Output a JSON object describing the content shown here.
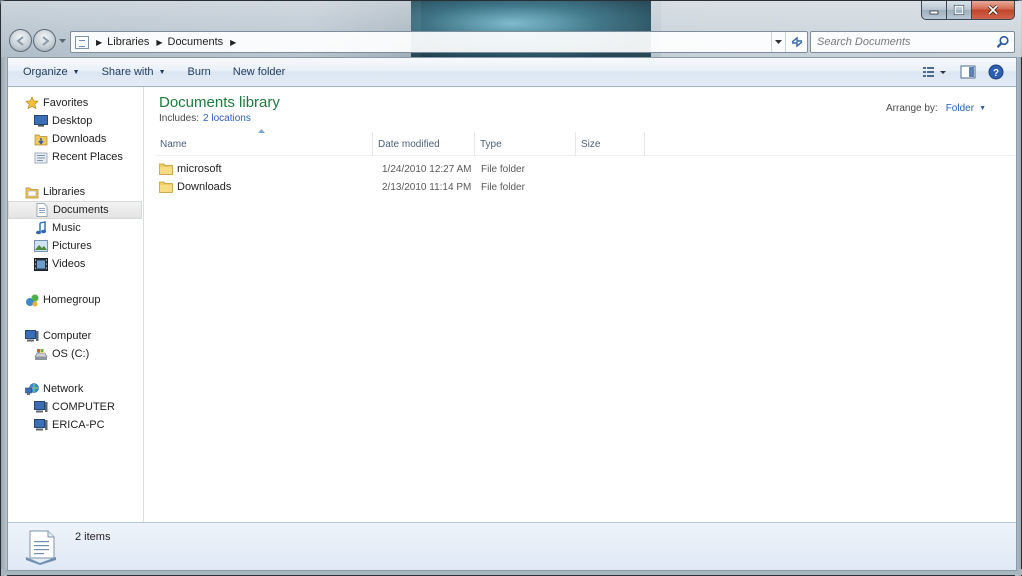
{
  "window": {
    "caption_buttons": {
      "minimize": "minimize-icon",
      "maximize": "maximize-icon",
      "close": "close-icon"
    }
  },
  "navigation": {
    "breadcrumbs": [
      "Libraries",
      "Documents"
    ],
    "search_placeholder": "Search Documents"
  },
  "toolbar": {
    "organize": "Organize",
    "share_with": "Share with",
    "burn": "Burn",
    "new_folder": "New folder"
  },
  "nav_pane": {
    "favorites": {
      "label": "Favorites",
      "items": [
        "Desktop",
        "Downloads",
        "Recent Places"
      ]
    },
    "libraries": {
      "label": "Libraries",
      "items": [
        "Documents",
        "Music",
        "Pictures",
        "Videos"
      ],
      "selected": "Documents"
    },
    "homegroup": {
      "label": "Homegroup"
    },
    "computer": {
      "label": "Computer",
      "items": [
        "OS (C:)"
      ]
    },
    "network": {
      "label": "Network",
      "items": [
        "COMPUTER",
        "ERICA-PC"
      ]
    }
  },
  "library": {
    "title": "Documents library",
    "includes_label": "Includes:",
    "includes_link": "2 locations",
    "arrange_label": "Arrange by:",
    "arrange_value": "Folder"
  },
  "columns": [
    "Name",
    "Date modified",
    "Type",
    "Size"
  ],
  "files": [
    {
      "name": "microsoft",
      "date": "1/24/2010 12:27 AM",
      "type": "File folder"
    },
    {
      "name": "Downloads",
      "date": "2/13/2010 11:14 PM",
      "type": "File folder"
    }
  ],
  "status": {
    "item_count": "2 items"
  },
  "colors": {
    "library_title": "#1e7a3c",
    "link": "#2a61b8",
    "toolbar_text": "#1e395b"
  }
}
